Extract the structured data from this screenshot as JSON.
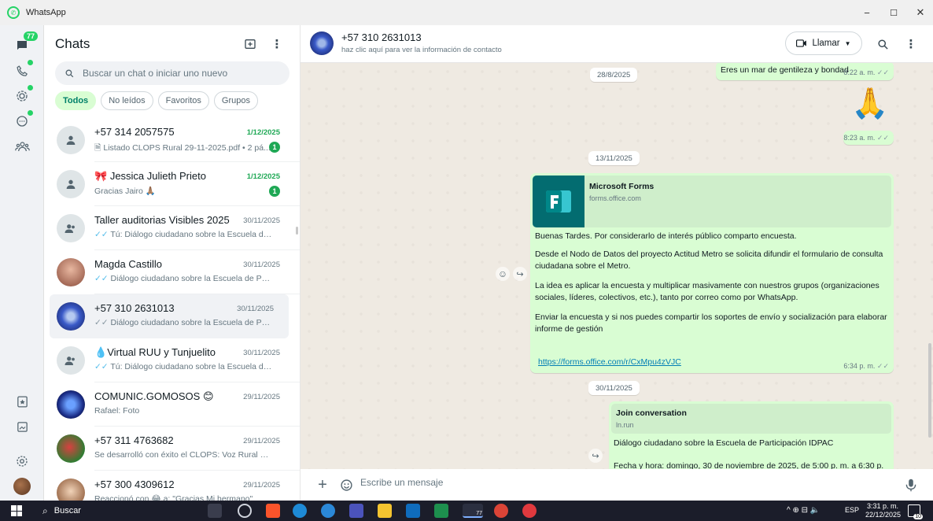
{
  "window": {
    "title": "WhatsApp",
    "minimize": "−",
    "maximize": "☐",
    "close": "✕"
  },
  "rail": {
    "chats_badge": "77"
  },
  "chatlist": {
    "title": "Chats",
    "search_placeholder": "Buscar un chat o iniciar uno nuevo",
    "filters": [
      "Todos",
      "No leídos",
      "Favoritos",
      "Grupos"
    ],
    "chats": [
      {
        "name": "+57 314 2057575",
        "date": "1/12/2025",
        "preview": "Listado CLOPS Rural 29-11-2025.pdf • 2 pá...",
        "unread": "1"
      },
      {
        "name": "Jessica Julieth Prieto",
        "date": "1/12/2025",
        "preview": "Gracias Jairo 🙏🏽",
        "unread": "1"
      },
      {
        "name": "Taller auditorias Visibles 2025",
        "date": "30/11/2025",
        "preview": "Tú: Diálogo ciudadano sobre la Escuela de Pa..."
      },
      {
        "name": "Magda Castillo",
        "date": "30/11/2025",
        "preview": "Diálogo ciudadano sobre la Escuela de Partici..."
      },
      {
        "name": "+57 310 2631013",
        "date": "30/11/2025",
        "preview": "Diálogo ciudadano sobre la Escuela de Partici..."
      },
      {
        "name": "Virtual RUU y Tunjuelito",
        "date": "30/11/2025",
        "preview": "Tú: Diálogo ciudadano sobre la Escuela de Pa..."
      },
      {
        "name": "COMUNIC.GOMOSOS 😊",
        "date": "29/11/2025",
        "preview": "Rafael: Foto"
      },
      {
        "name": "+57 311 4763682",
        "date": "29/11/2025",
        "preview": "Se desarrolló con éxito el CLOPS:  Voz Rural de C..."
      },
      {
        "name": "+57 300 4309612",
        "date": "29/11/2025",
        "preview": "Reaccionó con 😂 a: \"Gracias Mi hermano\""
      }
    ]
  },
  "chat": {
    "name": "+57 310 2631013",
    "subtitle": "haz clic aquí para ver la información de contacto",
    "call_label": "Llamar",
    "messages": {
      "m1_text": "Eres un mar de gentileza y bondad",
      "m1_time": "8:22 a. m.",
      "date1": "28/8/2025",
      "m2_emoji": "🙏",
      "m2_time": "8:23 a. m.",
      "date2": "13/11/2025",
      "card1_title": "Microsoft Forms",
      "card1_domain": "forms.office.com",
      "m3_p1": "Buenas Tardes. Por considerarlo de interés público comparto encuesta.",
      "m3_p2": "Desde el Nodo de Datos del proyecto Actitud Metro se solicita difundir el formulario de consulta ciudadana sobre el Metro.",
      "m3_p3": "La idea es aplicar la encuesta y multiplicar masivamente con nuestros grupos (organizaciones sociales, líderes, colectivos, etc.), tanto por correo como por WhatsApp.",
      "m3_p4": "Enviar la encuesta y si nos puedes compartir los soportes de envío y socialización para elaborar informe de gestión",
      "m3_link": "https://forms.office.com/r/CxMpu4zVJC",
      "m3_time": "6:34 p. m.",
      "date3": "30/11/2025",
      "card2_title": "Join conversation",
      "card2_domain": "ln.run",
      "m4_p1": "Diálogo ciudadano sobre la Escuela de Participación IDPAC",
      "m4_p2": "Fecha y hora: domingo, 30 de noviembre de 2025, de 5:00 p. m. a 6:30 p. m."
    },
    "composer_placeholder": "Escribe un mensaje"
  },
  "taskbar": {
    "search_label": "Buscar",
    "whatsapp_badge": "77",
    "lang": "ESP",
    "time": "3:31 p. m.",
    "date": "22/12/2025",
    "notif_count": "10"
  },
  "colors": {
    "accent": "#25d366",
    "outgoing_bubble": "#d9fdd3",
    "chat_bg": "#efeae2"
  }
}
